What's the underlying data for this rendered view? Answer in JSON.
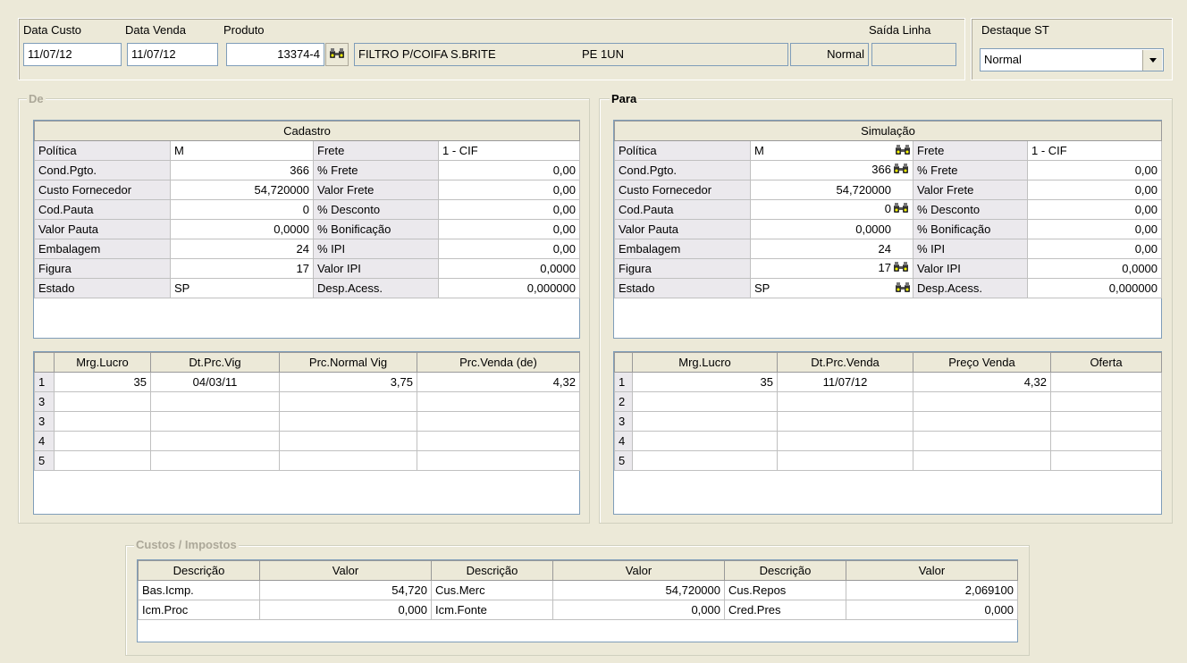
{
  "header": {
    "data_custo_label": "Data Custo",
    "data_custo": "11/07/12",
    "data_venda_label": "Data Venda",
    "data_venda": "11/07/12",
    "produto_label": "Produto",
    "produto_code": "13374-4",
    "produto_desc": "FILTRO P/COIFA S.BRITE",
    "produto_unit": "PE  1UN",
    "status": "Normal",
    "saida_linha_label": "Saída Linha",
    "saida_linha": "",
    "destaque_label": "Destaque ST",
    "destaque_value": "Normal"
  },
  "de": {
    "legend": "De",
    "section_title": "Cadastro",
    "rows": [
      {
        "l1": "Política",
        "v1": "M",
        "l2": "Frete",
        "v2": "1 - CIF"
      },
      {
        "l1": "Cond.Pgto.",
        "v1": "366",
        "l2": "% Frete",
        "v2": "0,00"
      },
      {
        "l1": "Custo Fornecedor",
        "v1": "54,720000",
        "l2": "Valor Frete",
        "v2": "0,00"
      },
      {
        "l1": "Cod.Pauta",
        "v1": "0",
        "l2": "% Desconto",
        "v2": "0,00"
      },
      {
        "l1": "Valor Pauta",
        "v1": "0,0000",
        "l2": "% Bonificação",
        "v2": "0,00"
      },
      {
        "l1": "Embalagem",
        "v1": "24",
        "l2": "% IPI",
        "v2": "0,00"
      },
      {
        "l1": "Figura",
        "v1": "17",
        "l2": "Valor IPI",
        "v2": "0,0000"
      },
      {
        "l1": "Estado",
        "v1": "SP",
        "l2": "Desp.Acess.",
        "v2": "0,000000"
      }
    ],
    "grid_headers": [
      "Mrg.Lucro",
      "Dt.Prc.Vig",
      "Prc.Normal Vig",
      "Prc.Venda (de)"
    ],
    "grid_rows": [
      {
        "n": "1",
        "c1": "35",
        "c2": "04/03/11",
        "c3": "3,75",
        "c4": "4,32"
      },
      {
        "n": "3",
        "c1": "",
        "c2": "",
        "c3": "",
        "c4": ""
      },
      {
        "n": "3",
        "c1": "",
        "c2": "",
        "c3": "",
        "c4": ""
      },
      {
        "n": "4",
        "c1": "",
        "c2": "",
        "c3": "",
        "c4": ""
      },
      {
        "n": "5",
        "c1": "",
        "c2": "",
        "c3": "",
        "c4": ""
      }
    ]
  },
  "para": {
    "legend": "Para",
    "section_title": "Simulação",
    "rows": [
      {
        "l1": "Política",
        "v1": "M",
        "l2": "Frete",
        "v2": "1 - CIF",
        "b": true
      },
      {
        "l1": "Cond.Pgto.",
        "v1": "366",
        "l2": "% Frete",
        "v2": "0,00",
        "b": true
      },
      {
        "l1": "Custo Fornecedor",
        "v1": "54,720000",
        "l2": "Valor Frete",
        "v2": "0,00",
        "b": false
      },
      {
        "l1": "Cod.Pauta",
        "v1": "0",
        "l2": "% Desconto",
        "v2": "0,00",
        "b": true
      },
      {
        "l1": "Valor Pauta",
        "v1": "0,0000",
        "l2": "% Bonificação",
        "v2": "0,00",
        "b": false
      },
      {
        "l1": "Embalagem",
        "v1": "24",
        "l2": "% IPI",
        "v2": "0,00",
        "b": false
      },
      {
        "l1": "Figura",
        "v1": "17",
        "l2": "Valor IPI",
        "v2": "0,0000",
        "b": true
      },
      {
        "l1": "Estado",
        "v1": "SP",
        "l2": "Desp.Acess.",
        "v2": "0,000000",
        "b": true
      }
    ],
    "grid_headers": [
      "Mrg.Lucro",
      "Dt.Prc.Venda",
      "Preço Venda",
      "Oferta"
    ],
    "grid_rows": [
      {
        "n": "1",
        "c1": "35",
        "c2": "11/07/12",
        "c3": "4,32",
        "c4": ""
      },
      {
        "n": "2",
        "c1": "",
        "c2": "",
        "c3": "",
        "c4": ""
      },
      {
        "n": "3",
        "c1": "",
        "c2": "",
        "c3": "",
        "c4": ""
      },
      {
        "n": "4",
        "c1": "",
        "c2": "",
        "c3": "",
        "c4": ""
      },
      {
        "n": "5",
        "c1": "",
        "c2": "",
        "c3": "",
        "c4": ""
      }
    ]
  },
  "custos": {
    "legend": "Custos / Impostos",
    "headers": [
      "Descrição",
      "Valor",
      "Descrição",
      "Valor",
      "Descrição",
      "Valor"
    ],
    "rows": [
      [
        "Bas.Icmp.",
        "54,720",
        "Cus.Merc",
        "54,720000",
        "Cus.Repos",
        "2,069100"
      ],
      [
        "Icm.Proc",
        "0,000",
        "Icm.Fonte",
        "0,000",
        "Cred.Pres",
        "0,000"
      ]
    ]
  }
}
